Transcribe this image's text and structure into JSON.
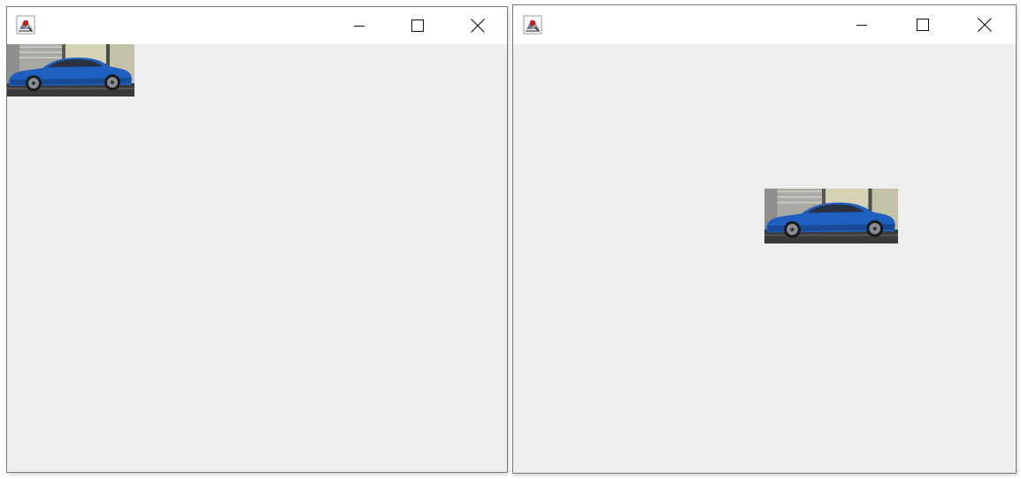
{
  "windows": [
    {
      "id": "left",
      "title": "",
      "image_alignment": "top-left",
      "image": "blue-coupe-car-photo"
    },
    {
      "id": "right",
      "title": "",
      "image_alignment": "center",
      "image": "blue-coupe-car-photo"
    }
  ],
  "icons": {
    "app": "java-app-icon",
    "minimize": "minimize-icon",
    "maximize": "maximize-icon",
    "close": "close-icon"
  },
  "colors": {
    "titlebar_bg": "#ffffff",
    "client_bg": "#eeeeee",
    "window_border": "#7a7a7a",
    "car_body": "#1e5fc0",
    "building_wall": "#b6b19c",
    "road": "#3a3a3a"
  }
}
